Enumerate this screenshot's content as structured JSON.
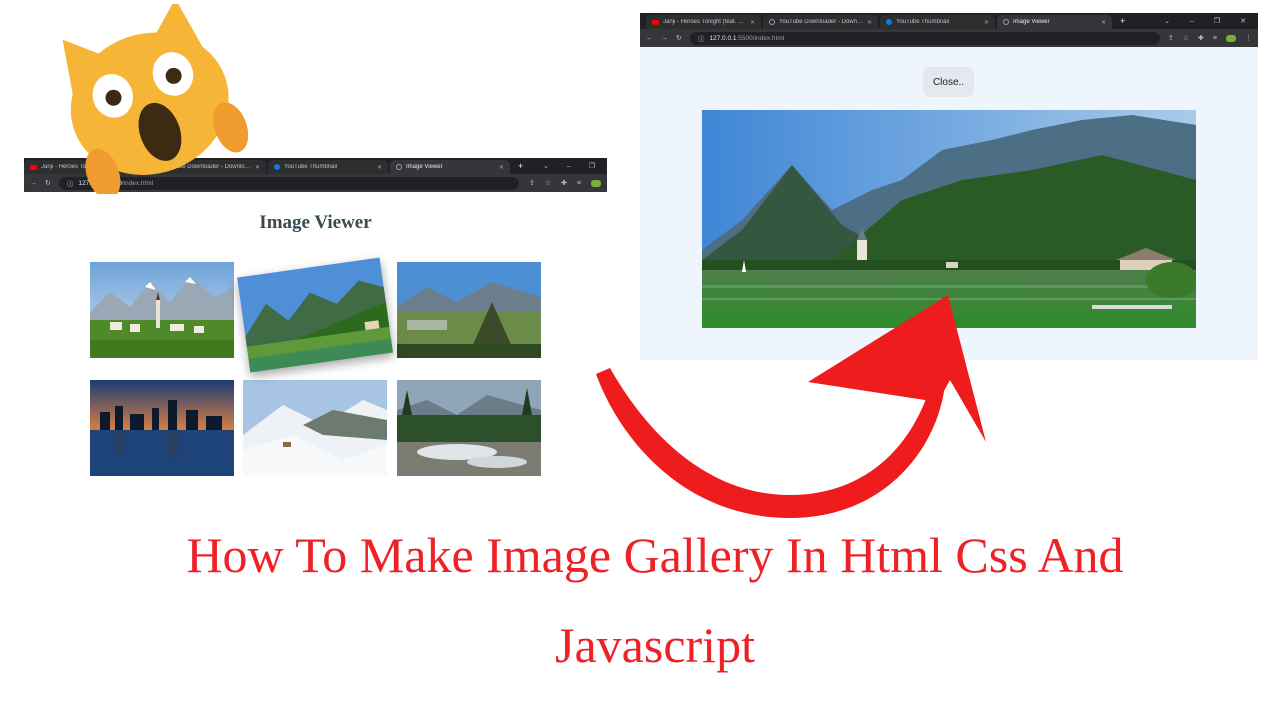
{
  "left_browser": {
    "tabs": [
      {
        "label": "Janji - Heroes Tonight (feat. Joh...",
        "favicon": "youtube-icon"
      },
      {
        "label": "YouTube Downloader - Download...",
        "favicon": "globe-icon"
      },
      {
        "label": "YouTube Thumbnail",
        "favicon": "blue-globe-icon"
      },
      {
        "label": "Image Viewer",
        "favicon": "globe-icon"
      }
    ],
    "new_tab": "+",
    "window_controls": {
      "dropdown": "⌄",
      "minimize": "–",
      "restore": "❐"
    },
    "address": {
      "host": "127.0.0.1:5500",
      "path": "/index.html"
    },
    "page": {
      "title": "Image Viewer"
    }
  },
  "right_browser": {
    "tabs": [
      {
        "label": "Janji - Heroes Tonight (feat. Joh...",
        "favicon": "youtube-icon"
      },
      {
        "label": "YouTube Downloader - Downl...",
        "favicon": "globe-icon"
      },
      {
        "label": "YouTube Thumbnail",
        "favicon": "blue-globe-icon"
      },
      {
        "label": "Image Viewer",
        "favicon": "globe-icon"
      }
    ],
    "new_tab": "+",
    "window_controls": {
      "dropdown": "⌄",
      "minimize": "–",
      "restore": "❐",
      "close": "✕"
    },
    "address": {
      "host": "127.0.0.1",
      "path": ":5500/index.html"
    },
    "page": {
      "close_button": "Close.."
    }
  },
  "headline": {
    "line1": "How To Make Image Gallery In Html Css And",
    "line2": "Javascript"
  },
  "colors": {
    "headline": "#ec2227",
    "arrow": "#ee1c1c",
    "emoji": "#f6b537"
  }
}
